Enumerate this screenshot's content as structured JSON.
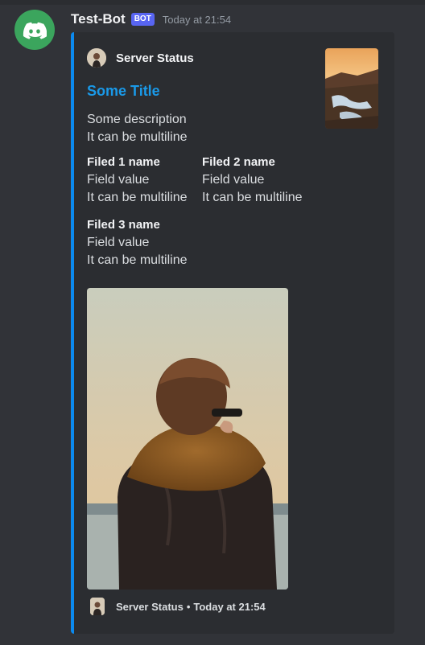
{
  "message": {
    "username": "Test-Bot",
    "badge": "BOT",
    "timestamp": "Today at 21:54"
  },
  "embed": {
    "author": "Server Status",
    "title": "Some Title",
    "description_lines": [
      "Some description",
      "It can be multiline"
    ],
    "fields": [
      {
        "name": "Filed 1 name",
        "value_lines": [
          "Field value",
          "It can be multiline"
        ]
      },
      {
        "name": "Filed 2 name",
        "value_lines": [
          "Field value",
          "It can be multiline"
        ]
      },
      {
        "name": "Filed 3 name",
        "value_lines": [
          "Field value",
          "It can be multiline"
        ]
      }
    ],
    "footer": {
      "text": "Server Status",
      "separator": "•",
      "timestamp": "Today at 21:54"
    },
    "accent_color": "#0b8aef",
    "title_color": "#1a99e8"
  },
  "icons": {
    "avatar": "discord-logo-icon",
    "thumbnail": "coastal-landscape-thumbnail",
    "image": "person-with-scarf-photo"
  }
}
